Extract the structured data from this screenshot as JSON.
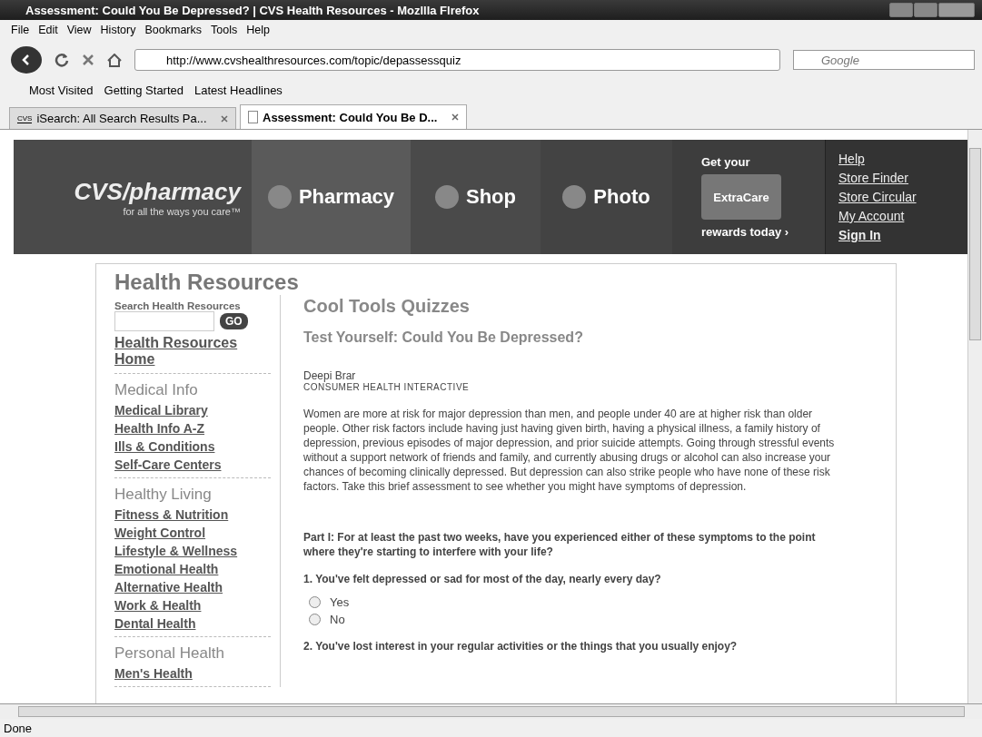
{
  "window": {
    "title": "Assessment: Could You Be Depressed? | CVS Health Resources - Mozllla Flrefox"
  },
  "menu": [
    "File",
    "Edit",
    "View",
    "History",
    "Bookmarks",
    "Tools",
    "Help"
  ],
  "address": {
    "url": "http://www.cvshealthresources.com/topic/depassessquiz"
  },
  "search": {
    "placeholder": "Google"
  },
  "bookmarks": [
    "Most Visited",
    "Getting Started",
    "Latest Headlines"
  ],
  "tabs": [
    {
      "label": "iSearch: All Search Results Pa...",
      "favicon": "CVS",
      "selected": false
    },
    {
      "label": "Assessment: Could You Be D...",
      "selected": true
    }
  ],
  "header": {
    "logo": "CVS/pharmacy",
    "tagline": "for all the ways you care™",
    "nav": [
      "Pharmacy",
      "Shop",
      "Photo"
    ],
    "promo_top": "Get your",
    "card_title": "ExtraCare",
    "promo_bottom": "rewards today ›",
    "links": [
      "Help",
      "Store Finder",
      "Store Circular",
      "My Account"
    ],
    "sign_in": "Sign In"
  },
  "sidebar": {
    "title": "Health Resources",
    "search_label": "Search Health Resources",
    "go": "GO",
    "home": "Health Resources Home",
    "sections": [
      {
        "heading": "Medical Info",
        "items": [
          "Medical Library",
          "Health Info A-Z",
          "Ills & Conditions",
          "Self-Care Centers"
        ]
      },
      {
        "heading": "Healthy Living",
        "items": [
          "Fitness & Nutrition",
          "Weight Control",
          "Lifestyle & Wellness",
          "Emotional Health",
          "Alternative Health",
          "Work & Health",
          "Dental Health"
        ]
      },
      {
        "heading": "Personal Health",
        "items": [
          "Men's Health"
        ]
      }
    ]
  },
  "main": {
    "heading": "Cool Tools Quizzes",
    "subtitle": "Test Yourself: Could You Be Depressed?",
    "author": "Deepi Brar",
    "organization": "CONSUMER HEALTH INTERACTIVE",
    "intro": "Women are more at risk for major depression than men, and people under 40 are at higher risk than older people. Other risk factors include having just having given birth, having a physical illness, a family history of depression, previous episodes of major depression, and prior suicide attempts. Going through stressful events without a support network of friends and family, and currently abusing drugs or alcohol can also increase your chances of becoming clinically depressed. But depression can also strike people who have none of these risk factors. Take this brief assessment to see whether you might have symptoms of depression.",
    "part": "Part I: For at least the past two weeks, have you experienced either of these symptoms to the point where they're starting to interfere with your life?",
    "questions": [
      {
        "text": "1. You've felt depressed or sad for most of the day, nearly every day?",
        "options": [
          {
            "label": "Yes",
            "selected": false
          },
          {
            "label": "No",
            "selected": false
          }
        ]
      },
      {
        "text": "2. You've lost interest in your regular activities or the things that you usually enjoy?"
      }
    ]
  },
  "status_bar": {
    "text": "Done"
  }
}
